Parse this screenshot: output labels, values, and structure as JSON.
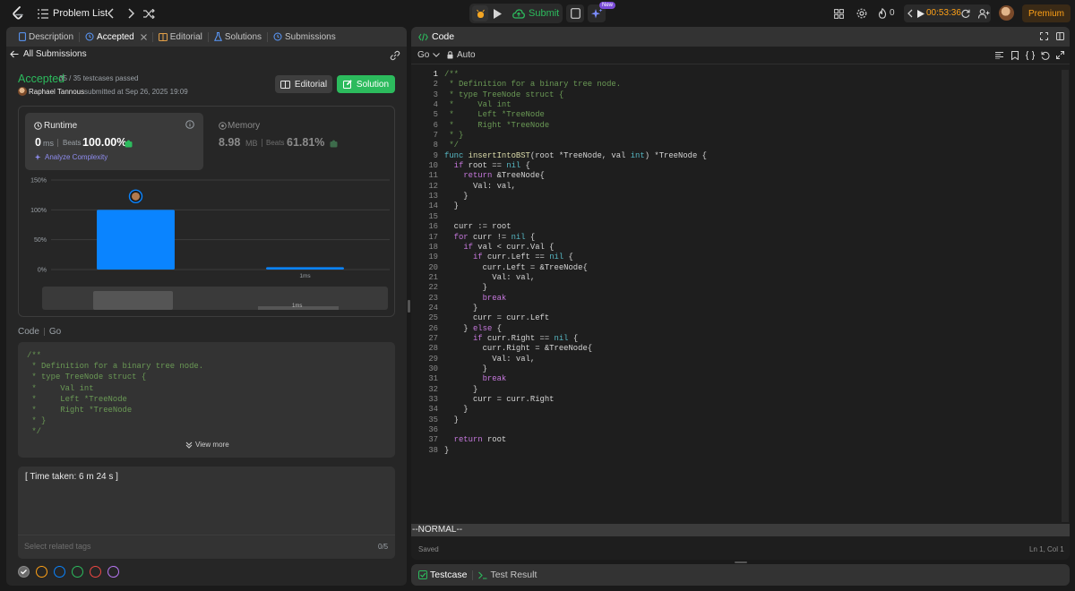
{
  "topbar": {
    "problem_list": "Problem List",
    "submit": "Submit",
    "new_badge": "New",
    "streak": "0",
    "timer": "00:53:36",
    "premium": "Premium"
  },
  "left_tabs": {
    "description": "Description",
    "accepted": "Accepted",
    "editorial": "Editorial",
    "solutions": "Solutions",
    "submissions": "Submissions"
  },
  "submission": {
    "back": "All Submissions",
    "status": "Accepted",
    "testcases": "35 / 35 testcases passed",
    "author": "Raphael Tannous",
    "submitted_text": "submitted at Sep 26, 2025 19:09",
    "editorial_btn": "Editorial",
    "solution_btn": "Solution"
  },
  "runtime": {
    "label": "Runtime",
    "value": "0",
    "unit": "ms",
    "beats_label": "Beats",
    "beats": "100.00%",
    "analyze": "Analyze Complexity"
  },
  "memory": {
    "label": "Memory",
    "value": "8.98",
    "unit": "MB",
    "beats_label": "Beats",
    "beats": "61.81%"
  },
  "chart_data": {
    "type": "bar",
    "categories": [
      "",
      "1ms"
    ],
    "values": [
      100,
      4
    ],
    "ylim": [
      0,
      150
    ],
    "yticks": [
      "0%",
      "50%",
      "100%",
      "150%"
    ],
    "grid": true,
    "highlight_index": 0,
    "bar_color": "#0a84ff",
    "minimap_label": "1ms"
  },
  "code_section": {
    "label": "Code",
    "lang": "Go",
    "preview": [
      "/**",
      " * Definition for a binary tree node.",
      " * type TreeNode struct {",
      " *     Val int",
      " *     Left *TreeNode",
      " *     Right *TreeNode",
      " * }",
      " */"
    ],
    "view_more": "View more"
  },
  "notes": {
    "text": "[ Time taken: 6 m 24 s ]",
    "tags_placeholder": "Select related tags",
    "tags_count": "0/5"
  },
  "note_colors": [
    "#9e9e9e",
    "#ffa116",
    "#0a84ff",
    "#2cbb5d",
    "#ef4743",
    "#b675f0"
  ],
  "editor": {
    "title": "Code",
    "lang": "Go",
    "auto": "Auto",
    "mode": "--NORMAL--",
    "saved": "Saved",
    "position": "Ln 1, Col 1"
  },
  "code_lines": [
    [
      [
        "cm",
        "/**"
      ]
    ],
    [
      [
        "cm",
        " * Definition for a binary tree node."
      ]
    ],
    [
      [
        "cm",
        " * type TreeNode struct {"
      ]
    ],
    [
      [
        "cm",
        " *     Val int"
      ]
    ],
    [
      [
        "cm",
        " *     Left *TreeNode"
      ]
    ],
    [
      [
        "cm",
        " *     Right *TreeNode"
      ]
    ],
    [
      [
        "cm",
        " * }"
      ]
    ],
    [
      [
        "cm",
        " */"
      ]
    ],
    [
      [
        "kwb",
        "func "
      ],
      [
        "fn",
        "insertIntoBST"
      ],
      [
        "pl",
        "(root *TreeNode, val "
      ],
      [
        "kwb",
        "int"
      ],
      [
        "pl",
        ") *TreeNode {"
      ]
    ],
    [
      [
        "pl",
        "  "
      ],
      [
        "kw",
        "if"
      ],
      [
        "pl",
        " root == "
      ],
      [
        "kwb",
        "nil"
      ],
      [
        "pl",
        " {"
      ]
    ],
    [
      [
        "pl",
        "    "
      ],
      [
        "kw",
        "return"
      ],
      [
        "pl",
        " &TreeNode{"
      ]
    ],
    [
      [
        "pl",
        "      Val: val,"
      ]
    ],
    [
      [
        "pl",
        "    }"
      ]
    ],
    [
      [
        "pl",
        "  }"
      ]
    ],
    [
      [
        "pl",
        ""
      ]
    ],
    [
      [
        "pl",
        "  curr := root"
      ]
    ],
    [
      [
        "pl",
        "  "
      ],
      [
        "kw",
        "for"
      ],
      [
        "pl",
        " curr != "
      ],
      [
        "kwb",
        "nil"
      ],
      [
        "pl",
        " {"
      ]
    ],
    [
      [
        "pl",
        "    "
      ],
      [
        "kw",
        "if"
      ],
      [
        "pl",
        " val < curr.Val {"
      ]
    ],
    [
      [
        "pl",
        "      "
      ],
      [
        "kw",
        "if"
      ],
      [
        "pl",
        " curr.Left == "
      ],
      [
        "kwb",
        "nil"
      ],
      [
        "pl",
        " {"
      ]
    ],
    [
      [
        "pl",
        "        curr.Left = &TreeNode{"
      ]
    ],
    [
      [
        "pl",
        "          Val: val,"
      ]
    ],
    [
      [
        "pl",
        "        }"
      ]
    ],
    [
      [
        "pl",
        "        "
      ],
      [
        "kw",
        "break"
      ]
    ],
    [
      [
        "pl",
        "      }"
      ]
    ],
    [
      [
        "pl",
        "      curr = curr.Left"
      ]
    ],
    [
      [
        "pl",
        "    } "
      ],
      [
        "kw",
        "else"
      ],
      [
        "pl",
        " {"
      ]
    ],
    [
      [
        "pl",
        "      "
      ],
      [
        "kw",
        "if"
      ],
      [
        "pl",
        " curr.Right == "
      ],
      [
        "kwb",
        "nil"
      ],
      [
        "pl",
        " {"
      ]
    ],
    [
      [
        "pl",
        "        curr.Right = &TreeNode{"
      ]
    ],
    [
      [
        "pl",
        "          Val: val,"
      ]
    ],
    [
      [
        "pl",
        "        }"
      ]
    ],
    [
      [
        "pl",
        "        "
      ],
      [
        "kw",
        "break"
      ]
    ],
    [
      [
        "pl",
        "      }"
      ]
    ],
    [
      [
        "pl",
        "      curr = curr.Right"
      ]
    ],
    [
      [
        "pl",
        "    }"
      ]
    ],
    [
      [
        "pl",
        "  }"
      ]
    ],
    [
      [
        "pl",
        ""
      ]
    ],
    [
      [
        "pl",
        "  "
      ],
      [
        "kw",
        "return"
      ],
      [
        "pl",
        " root"
      ]
    ],
    [
      [
        "pl",
        "}"
      ]
    ]
  ],
  "bottom": {
    "testcase": "Testcase",
    "test_result": "Test Result"
  }
}
